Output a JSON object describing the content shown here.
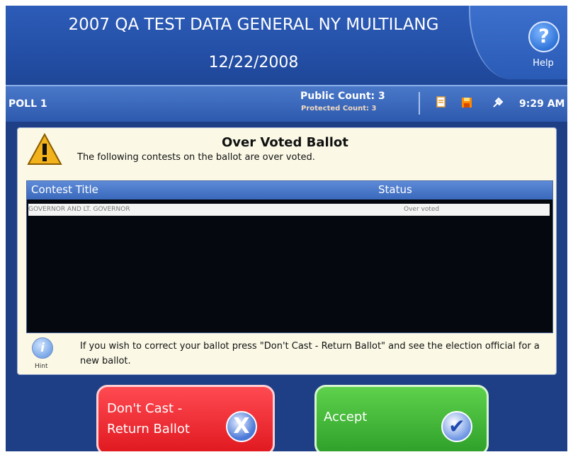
{
  "header": {
    "title": "2007 QA TEST DATA GENERAL NY MULTILANG",
    "date": "12/22/2008",
    "help_label": "Help",
    "help_glyph": "?"
  },
  "statusbar": {
    "poll": "POLL 1",
    "public_count": "Public Count: 3",
    "protected_count": "Protected Count: 3",
    "time": "9:29 AM",
    "icons": [
      "printer-icon",
      "disk-icon",
      "power-plug-icon"
    ]
  },
  "dialog": {
    "title": "Over Voted Ballot",
    "subtitle": "The following contests on the ballot are over voted.",
    "table": {
      "columns": [
        "Contest Title",
        "Status"
      ],
      "rows": [
        {
          "contest": "GOVERNOR AND LT. GOVERNOR",
          "status": "Over voted"
        }
      ]
    },
    "hint_label": "Hint",
    "hint_glyph": "i",
    "hint_text": "If you wish to correct your ballot press \"Don't Cast - Return Ballot\" and see the election official for a new ballot."
  },
  "buttons": {
    "dont_cast_line1": "Don't Cast -",
    "dont_cast_line2": "Return Ballot",
    "dont_cast_glyph": "X",
    "accept": "Accept",
    "accept_glyph": "✔"
  },
  "colors": {
    "background": "#1e3f86",
    "dialog": "#fbf9e6",
    "dont_cast": "#e0181f",
    "accept": "#2ea02a"
  }
}
